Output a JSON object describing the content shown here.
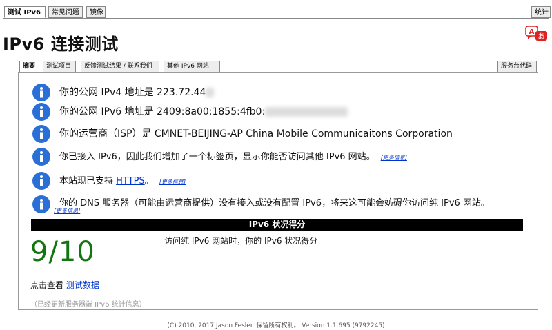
{
  "top_tabs": [
    "测试 IPv6",
    "常见问题",
    "镜像"
  ],
  "stats_tab": "统计",
  "page_title": "IPv6 连接测试",
  "sub_tabs": [
    "摘要",
    "测试项目",
    "反馈测试结果 / 联系我们",
    "其他 IPv6 网站"
  ],
  "code_tab": "服务台代码",
  "rows": {
    "ipv4": "你的公网 IPv4 地址是 223.72.44",
    "ipv6": "你的公网 IPv6 地址是 2409:8a00:1855:4fb0:",
    "isp": "你的运营商（ISP）是 CMNET-BEIJING-AP China Mobile Communicaitons Corporation",
    "has_ipv6": "你已接入 IPv6，因此我们增加了一个标签页，显示你能否访问其他 IPv6 网站。",
    "https_prefix": "本站现已支持",
    "https_link": "HTTPS",
    "https_suffix": "。",
    "dns": "你的 DNS 服务器（可能由运营商提供）没有接入或没有配置 IPv6，将来这可能会妨碍你访问纯 IPv6 网站。"
  },
  "more_info": "[更多信息]",
  "score_bar": "IPv6 状况得分",
  "score": "9/10",
  "score_desc": "访问纯 IPv6 网站时，你的 IPv6 状况得分",
  "view_data_prefix": "点击查看",
  "view_data_link": "测试数据",
  "updated": "（已经更新服务器端 IPv6 统计信息）",
  "footer": "(C) 2010, 2017 Jason Fesler. 保留所有权利。 Version 1.1.695 (9792245)",
  "colors": {
    "info_icon": "#2a6fd6",
    "score": "#127512",
    "link": "#0033cc"
  }
}
